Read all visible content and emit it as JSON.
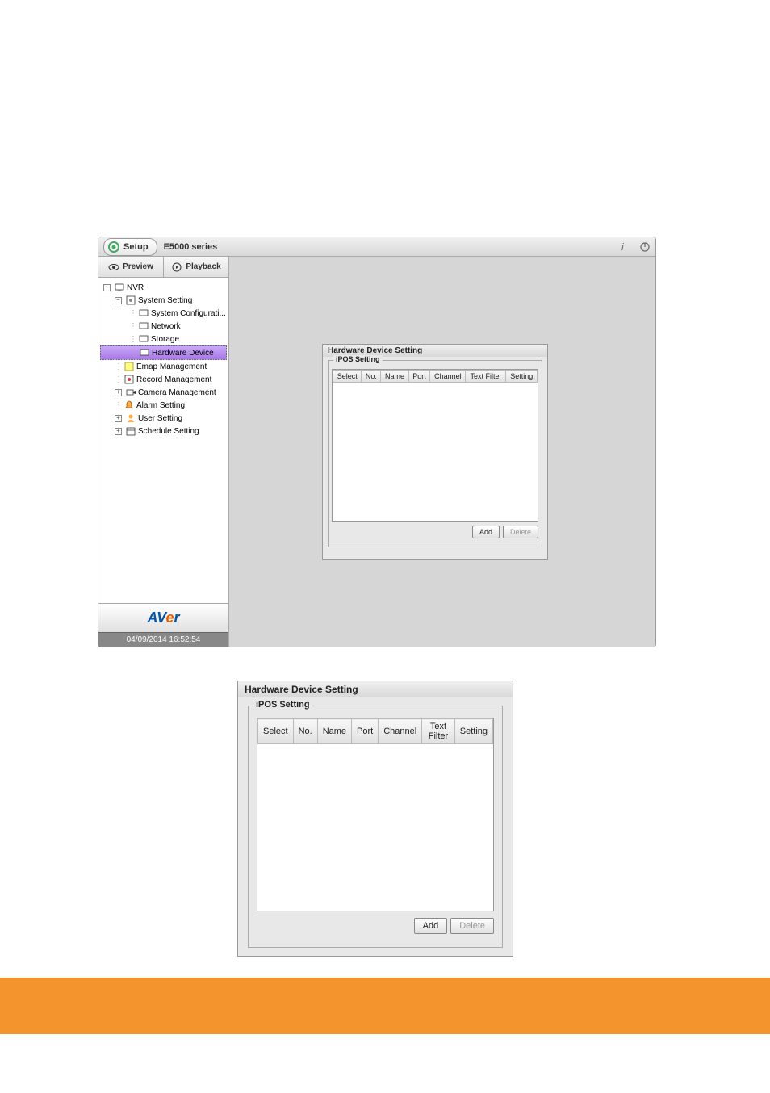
{
  "titlebar": {
    "setup_label": "Setup",
    "title": "E5000 series"
  },
  "tabs": {
    "preview": "Preview",
    "playback": "Playback"
  },
  "tree": {
    "root": "NVR",
    "system_setting": "System Setting",
    "system_configurati": "System Configurati...",
    "network": "Network",
    "storage": "Storage",
    "hardware_device": "Hardware Device",
    "emap_management": "Emap Management",
    "record_management": "Record Management",
    "camera_management": "Camera Management",
    "alarm_setting": "Alarm Setting",
    "user_setting": "User Setting",
    "schedule_setting": "Schedule Setting"
  },
  "logo": {
    "av": "AV",
    "e": "e",
    "r": "r"
  },
  "timestamp": "04/09/2014 16:52:54",
  "panel": {
    "title": "Hardware Device Setting",
    "fieldset": "iPOS Setting",
    "headers": {
      "select": "Select",
      "no": "No.",
      "name": "Name",
      "port": "Port",
      "channel": "Channel",
      "text_filter": "Text Filter",
      "setting": "Setting"
    },
    "add": "Add",
    "delete": "Delete"
  }
}
